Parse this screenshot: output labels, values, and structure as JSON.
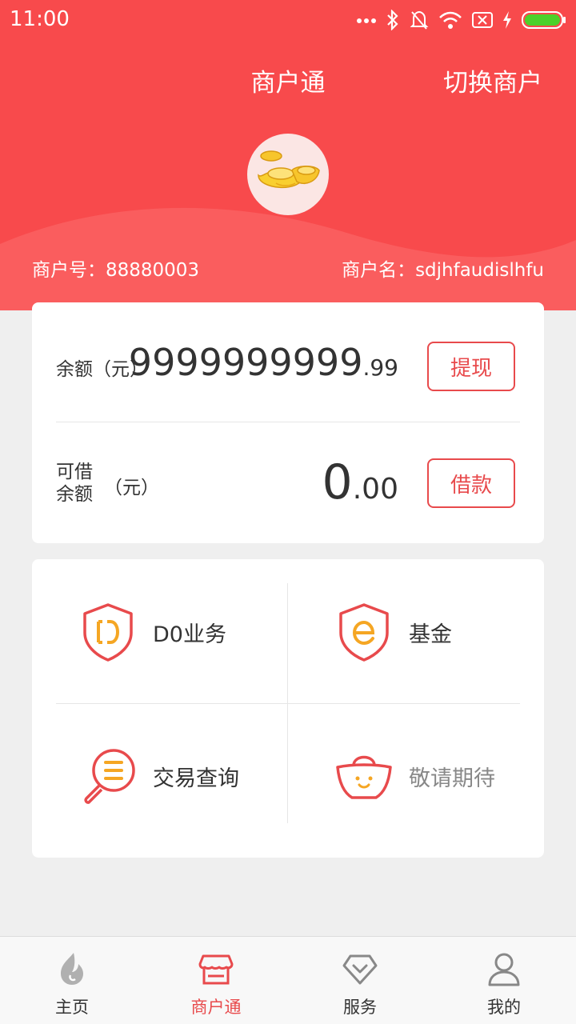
{
  "status_bar": {
    "time": "11:00"
  },
  "header": {
    "title": "商户通",
    "switch_label": "切换商户",
    "merchant_id_label": "商户号：",
    "merchant_id": "88880003",
    "merchant_name_label": "商户名：",
    "merchant_name": "sdjhfaudislhfu"
  },
  "balance": {
    "label": "余额（元）",
    "amount_int": "9999999999",
    "amount_dec": ".99",
    "action": "提现"
  },
  "loan": {
    "label_line1": "可借",
    "label_line2": "余额",
    "unit": "（元）",
    "amount_int": "0",
    "amount_dec": ".00",
    "action": "借款"
  },
  "services": [
    {
      "label": "D0业务",
      "icon": "d0-shield-icon"
    },
    {
      "label": "基金",
      "icon": "fund-shield-icon"
    },
    {
      "label": "交易查询",
      "icon": "search-list-icon"
    },
    {
      "label": "敬请期待",
      "icon": "coming-soon-basket-icon"
    }
  ],
  "tabs": [
    {
      "label": "主页",
      "icon": "home-flame-icon",
      "active": false
    },
    {
      "label": "商户通",
      "icon": "shop-icon",
      "active": true
    },
    {
      "label": "服务",
      "icon": "diamond-icon",
      "active": false
    },
    {
      "label": "我的",
      "icon": "user-icon",
      "active": false
    }
  ],
  "colors": {
    "brand_red": "#f84a4c",
    "accent_orange": "#f5a623",
    "background": "#efefef"
  }
}
